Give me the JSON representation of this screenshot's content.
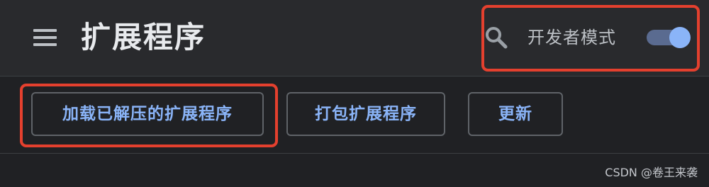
{
  "header": {
    "title": "扩展程序",
    "menu_icon": "menu-icon",
    "search_icon": "search-icon",
    "dev_mode_label": "开发者模式",
    "dev_mode_enabled": true
  },
  "toolbar": {
    "load_unpacked_label": "加载已解压的扩展程序",
    "pack_label": "打包扩展程序",
    "update_label": "更新"
  },
  "watermark": "CSDN @卷王来袭",
  "colors": {
    "header_bg": "#292a2d",
    "page_bg": "#202124",
    "accent": "#8ab4f8",
    "annotation": "#e4402e"
  }
}
